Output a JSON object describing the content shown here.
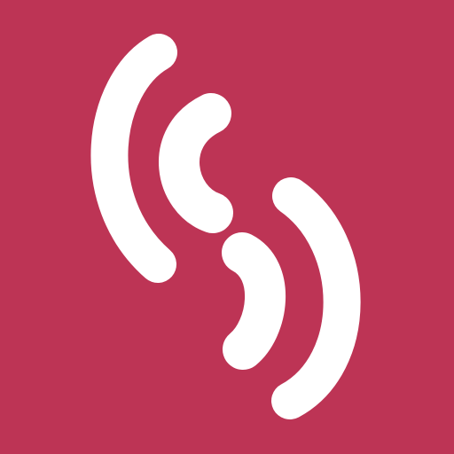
{
  "app_icon": {
    "icon_name": "signal-waves-logo-icon",
    "background_color": "#BD3455",
    "foreground_color": "#FFFFFF"
  }
}
